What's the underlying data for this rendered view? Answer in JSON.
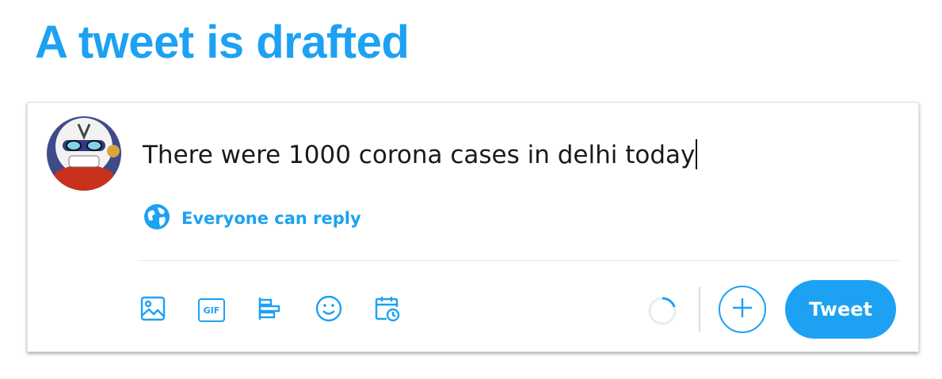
{
  "headline": "A tweet is drafted",
  "composer": {
    "text": "There were 1000 corona cases in delhi today",
    "reply_setting": "Everyone can reply",
    "tweet_button_label": "Tweet"
  },
  "toolbar": {
    "icons": [
      "image-icon",
      "gif-icon",
      "poll-icon",
      "emoji-icon",
      "schedule-icon"
    ],
    "gif_badge": "GIF"
  },
  "colors": {
    "accent": "#1da1f2",
    "headline": "#1da1f2",
    "text": "#1a1a1a",
    "divider": "#e6ecf0"
  }
}
